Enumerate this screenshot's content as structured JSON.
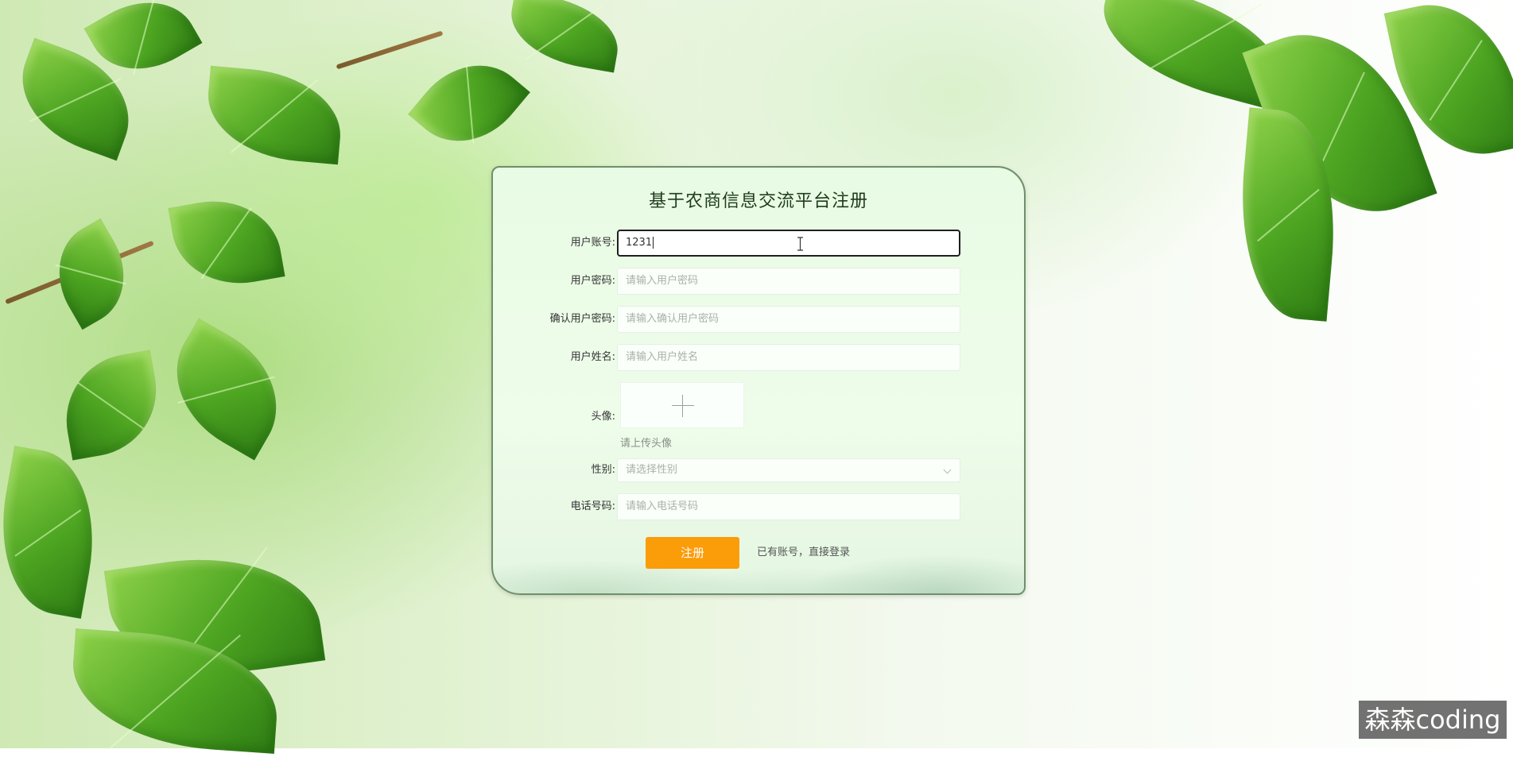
{
  "form": {
    "title": "基于农商信息交流平台注册",
    "fields": {
      "account": {
        "label": "用户账号:",
        "value": "1231",
        "placeholder": ""
      },
      "password": {
        "label": "用户密码:",
        "value": "",
        "placeholder": "请输入用户密码"
      },
      "confirm_password": {
        "label": "确认用户密码:",
        "value": "",
        "placeholder": "请输入确认用户密码"
      },
      "name": {
        "label": "用户姓名:",
        "value": "",
        "placeholder": "请输入用户姓名"
      },
      "avatar": {
        "label": "头像:",
        "tip": "请上传头像"
      },
      "gender": {
        "label": "性别:",
        "placeholder": "请选择性别"
      },
      "phone": {
        "label": "电话号码:",
        "value": "",
        "placeholder": "请输入电话号码"
      }
    },
    "register_button": "注册",
    "login_link": "已有账号，直接登录"
  },
  "watermark": "森森coding",
  "colors": {
    "register_button": "#fb9c09",
    "card_background": "#eefcea",
    "card_border": "#6f8f6b"
  }
}
